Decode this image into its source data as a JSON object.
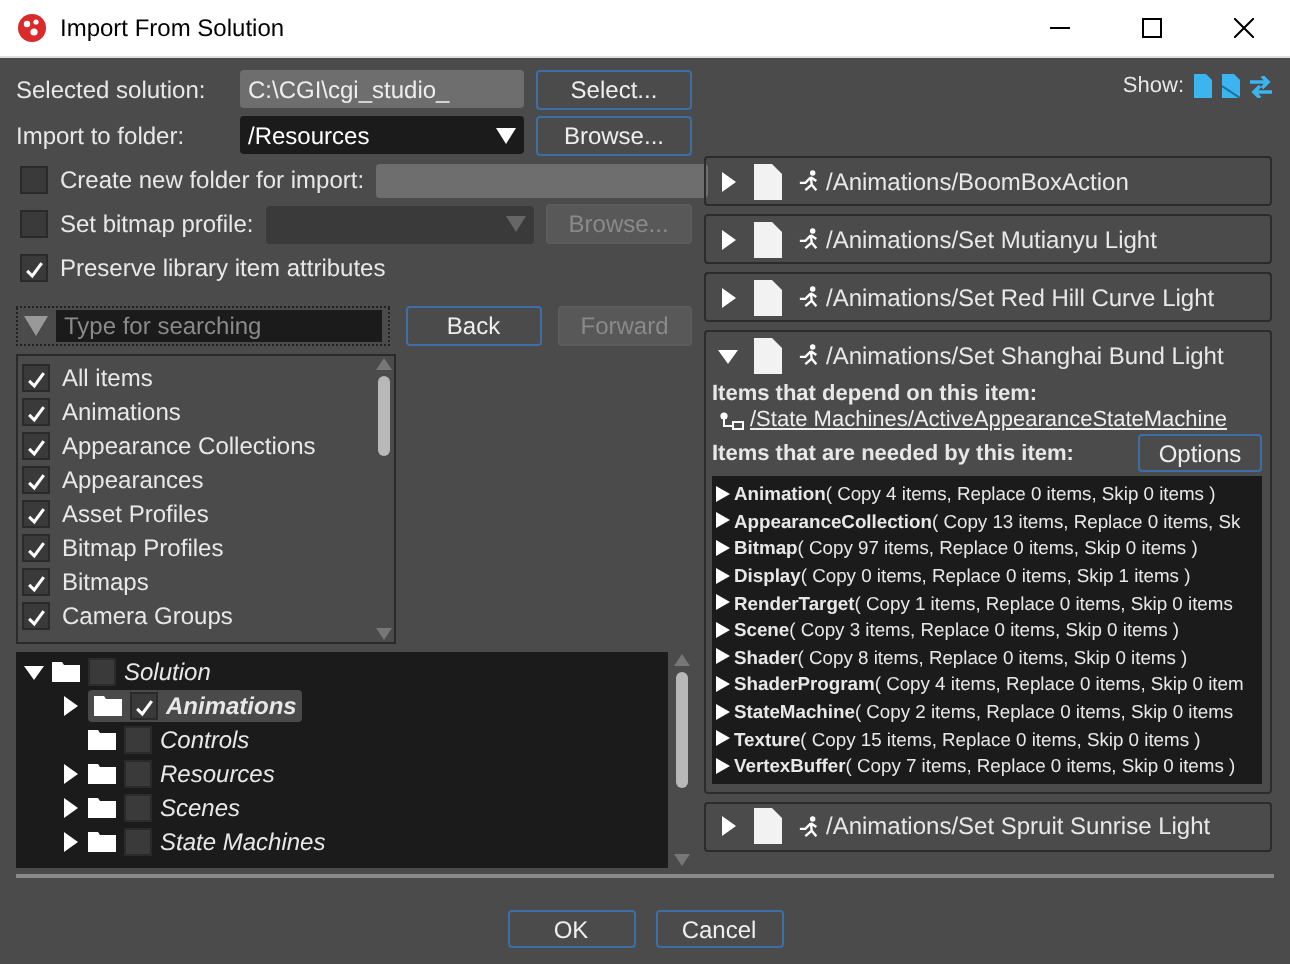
{
  "window": {
    "title": "Import From Solution"
  },
  "form": {
    "selected_solution": {
      "label": "Selected solution:",
      "value": "C:\\CGI\\cgi_studio_",
      "button": "Select..."
    },
    "import_folder": {
      "label": "Import to folder:",
      "value": "/Resources",
      "button": "Browse..."
    },
    "create_folder": {
      "label": "Create new folder for import:",
      "checked": false
    },
    "bitmap_profile": {
      "label": "Set bitmap profile:",
      "checked": false,
      "button": "Browse...",
      "disabled": true
    },
    "preserve": {
      "label": "Preserve library item attributes",
      "checked": true
    }
  },
  "search": {
    "placeholder": "Type for searching",
    "back": "Back",
    "forward": "Forward",
    "forward_disabled": true
  },
  "filters": [
    {
      "label": "All items",
      "checked": true
    },
    {
      "label": "Animations",
      "checked": true
    },
    {
      "label": "Appearance Collections",
      "checked": true
    },
    {
      "label": "Appearances",
      "checked": true
    },
    {
      "label": "Asset Profiles",
      "checked": true
    },
    {
      "label": "Bitmap Profiles",
      "checked": true
    },
    {
      "label": "Bitmaps",
      "checked": true
    },
    {
      "label": "Camera Groups",
      "checked": true
    }
  ],
  "tree": {
    "label": "Solution",
    "checked": false,
    "expanded": true,
    "selected": false,
    "expandable": true,
    "children": [
      {
        "label": "Animations",
        "checked": true,
        "selected": true,
        "expandable": true
      },
      {
        "label": "Controls",
        "checked": false,
        "selected": false,
        "expandable": false
      },
      {
        "label": "Resources",
        "checked": false,
        "selected": false,
        "expandable": true
      },
      {
        "label": "Scenes",
        "checked": false,
        "selected": false,
        "expandable": true
      },
      {
        "label": "State Machines",
        "checked": false,
        "selected": false,
        "expandable": true
      }
    ]
  },
  "show": {
    "label": "Show:"
  },
  "items": [
    {
      "path": "/Animations/BoomBoxAction",
      "expanded": false
    },
    {
      "path": "/Animations/Set Mutianyu Light",
      "expanded": false
    },
    {
      "path": "/Animations/Set Red Hill Curve Light",
      "expanded": false
    },
    {
      "path": "/Animations/Set Shanghai Bund Light",
      "expanded": true,
      "depend_title": "Items that depend on this item:",
      "dependents": [
        "/State Machines/ActiveAppearanceStateMachine"
      ],
      "needed_title": "Items that are needed by this item:",
      "options": "Options",
      "needed": [
        {
          "name": "Animation",
          "detail": "( Copy 4 items, Replace 0 items, Skip 0 items )"
        },
        {
          "name": "AppearanceCollection",
          "detail": "( Copy 13 items, Replace 0 items, Sk"
        },
        {
          "name": "Bitmap",
          "detail": "( Copy 97 items, Replace 0 items, Skip 0 items )"
        },
        {
          "name": "Display",
          "detail": "( Copy 0 items, Replace 0 items, Skip 1 items )"
        },
        {
          "name": "RenderTarget",
          "detail": "( Copy 1 items, Replace 0 items, Skip 0 items"
        },
        {
          "name": "Scene",
          "detail": "( Copy 3 items, Replace 0 items, Skip 0 items )"
        },
        {
          "name": "Shader",
          "detail": "( Copy 8 items, Replace 0 items, Skip 0 items )"
        },
        {
          "name": "ShaderProgram",
          "detail": "( Copy 4 items, Replace 0 items, Skip 0 item"
        },
        {
          "name": "StateMachine",
          "detail": "( Copy 2 items, Replace 0 items, Skip 0 items"
        },
        {
          "name": "Texture",
          "detail": "( Copy 15 items, Replace 0 items, Skip 0 items )"
        },
        {
          "name": "VertexBuffer",
          "detail": "( Copy 7 items, Replace 0 items, Skip 0 items )"
        }
      ]
    },
    {
      "path": "/Animations/Set Spruit Sunrise Light",
      "expanded": false
    }
  ],
  "buttons": [
    "OK",
    "Cancel"
  ]
}
